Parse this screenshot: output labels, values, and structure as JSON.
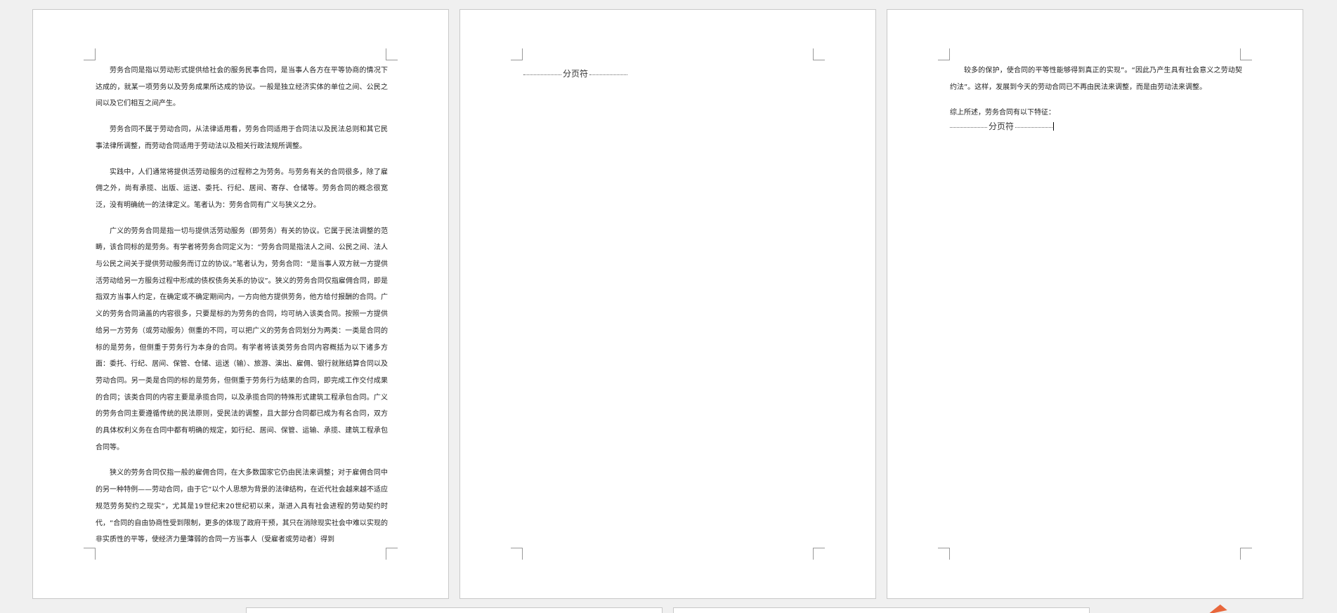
{
  "document": {
    "page1": {
      "paragraphs": [
        "劳务合同是指以劳动形式提供给社会的服务民事合同，是当事人各方在平等协商的情况下达成的，就某一项劳务以及劳务成果所达成的协议。一般是独立经济实体的单位之间、公民之间以及它们相互之间产生。",
        "劳务合同不属于劳动合同，从法律适用看，劳务合同适用于合同法以及民法总则和其它民事法律所调整，而劳动合同适用于劳动法以及相关行政法规所调整。",
        "实践中，人们通常将提供活劳动服务的过程称之为劳务。与劳务有关的合同很多，除了雇佣之外，尚有承揽、出版、运送、委托、行纪、居间、寄存、仓储等。劳务合同的概念很宽泛，没有明确统一的法律定义。笔者认为：劳务合同有广义与狭义之分。",
        "广义的劳务合同是指一切与提供活劳动服务（即劳务）有关的协议。它属于民法调整的范畴，该合同标的是劳务。有学者将劳务合同定义为：“劳务合同是指法人之间、公民之间、法人与公民之间关于提供劳动服务而订立的协议。”笔者认为，劳务合同：“是当事人双方就一方提供活劳动给另一方服务过程中形成的债权债务关系的协议”。狭义的劳务合同仅指雇佣合同，即是指双方当事人约定，在确定或不确定期间内，一方向他方提供劳务，他方给付报酬的合同。广义的劳务合同涵盖的内容很多，只要是标的为劳务的合同，均可纳入该类合同。按照一方提供给另一方劳务（或劳动服务）侧重的不同，可以把广义的劳务合同划分为两类：一类是合同的标的是劳务，但侧重于劳务行为本身的合同。有学者将该类劳务合同内容概括为以下诸多方面：委托、行纪、居间、保管、仓储、运送（输）、旅游、演出、雇佣、银行就账结算合同以及劳动合同。另一类是合同的标的是劳务，但侧重于劳务行为结果的合同，即完成工作交付成果的合同；该类合同的内容主要是承揽合同，以及承揽合同的特殊形式建筑工程承包合同。广义的劳务合同主要遵循传统的民法原则，受民法的调整，且大部分合同都已成为有名合同，双方的具体权利义务在合同中都有明确的规定，如行纪、居间、保管、运输、承揽、建筑工程承包合同等。",
        "狭义的劳务合同仅指一般的雇佣合同，在大多数国家它仍由民法来调整；对于雇佣合同中的另一种特例——劳动合同，由于它“以个人思想为背景的法律结构，在近代社会越来越不适应规范劳务契约之现实”，尤其是19世纪末20世纪初以来，渐进入具有社会进程的劳动契约时代，“合同的自由协商性受到限制，更多的体现了政府干预，其只在消除现实社会中难以实现的非实质性的平等，使经济力量薄弱的合同一方当事人（受雇者或劳动者）得到"
      ]
    },
    "page2": {
      "page_break_label": "分页符"
    },
    "page3": {
      "paragraphs": [
        "较多的保护，使合同的平等性能够得到真正的实现”。“因此乃产生具有社会意义之劳动契约法”。这样，发展到今天的劳动合同已不再由民法来调整，而是由劳动法来调整。",
        "综上所述，劳务合同有以下特征："
      ],
      "page_break_label": "分页符"
    }
  },
  "colors": {
    "workspace_bg": "#f0f0f0",
    "page_bg": "#ffffff",
    "accent_arrow": "#e8673c"
  }
}
